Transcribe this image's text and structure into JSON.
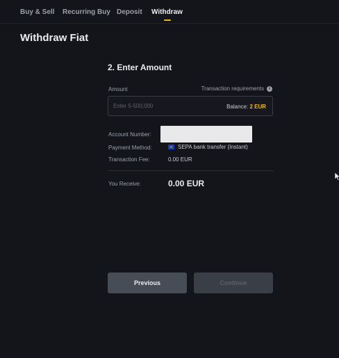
{
  "nav": {
    "tabs": [
      {
        "label": "Buy & Sell"
      },
      {
        "label": "Recurring Buy"
      },
      {
        "label": "Deposit"
      },
      {
        "label": "Withdraw",
        "active": true
      }
    ]
  },
  "page": {
    "title": "Withdraw Fiat"
  },
  "step": {
    "title": "2. Enter Amount"
  },
  "amount": {
    "label": "Amount",
    "requirements_label": "Transaction requirements",
    "placeholder": "Enter 5-500,000",
    "value": "",
    "balance_label": "Balance:",
    "balance_value": "2 EUR"
  },
  "details": {
    "account_number_label": "Account Number:",
    "payment_method_label": "Payment Method:",
    "payment_method_value": "SEPA bank transfer (Instant)",
    "transaction_fee_label": "Transaction Fee:",
    "transaction_fee_value": "0.00 EUR"
  },
  "receive": {
    "label": "You Receive:",
    "value": "0.00 EUR"
  },
  "buttons": {
    "previous": "Previous",
    "continue": "Continue"
  },
  "colors": {
    "background": "#14151a",
    "accent": "#f0b90b",
    "button_primary_bg": "#474d57",
    "button_disabled_bg": "#3a3f47"
  },
  "icons": {
    "info": "info-icon",
    "payment_method": "eu-flag-icon",
    "pointer": "mouse-cursor-icon"
  }
}
